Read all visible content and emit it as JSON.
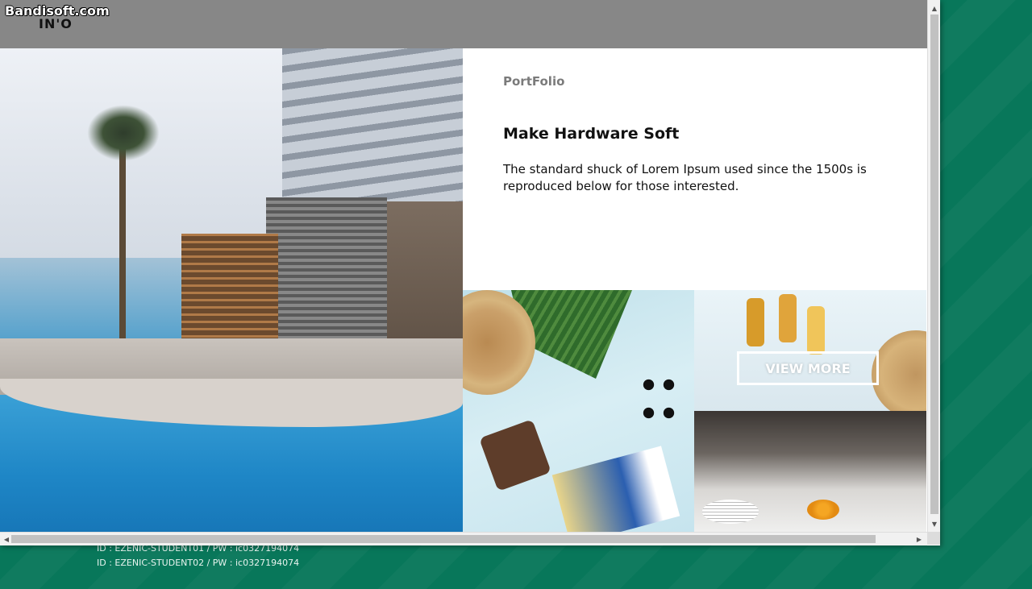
{
  "watermark": "Bandisoft.com",
  "header": {
    "logo": "IN'O"
  },
  "intro": {
    "eyebrow": "PortFolio",
    "title": "Make Hardware Soft",
    "description": "The standard shuck of Lorem Ipsum used since the 1500s is reproduced below for those interested."
  },
  "gallery": {
    "view_more_label": "VIEW MORE",
    "images": [
      "resort-pool-image",
      "summer-items-image",
      "drinks-image",
      "buffet-image"
    ]
  },
  "desktop": {
    "credentials": [
      "ID : EZENIC-STUDENT01 / PW : ic0327194074",
      "ID : EZENIC-STUDENT02 / PW : ic0327194074"
    ]
  },
  "colors": {
    "header_bg": "#878787",
    "desktop_bg": "#08775a",
    "panel_bg": "#ffffff"
  },
  "icons": {
    "scroll_up": "triangle-up",
    "scroll_down": "triangle-down",
    "scroll_left": "triangle-left",
    "scroll_right": "triangle-right"
  }
}
